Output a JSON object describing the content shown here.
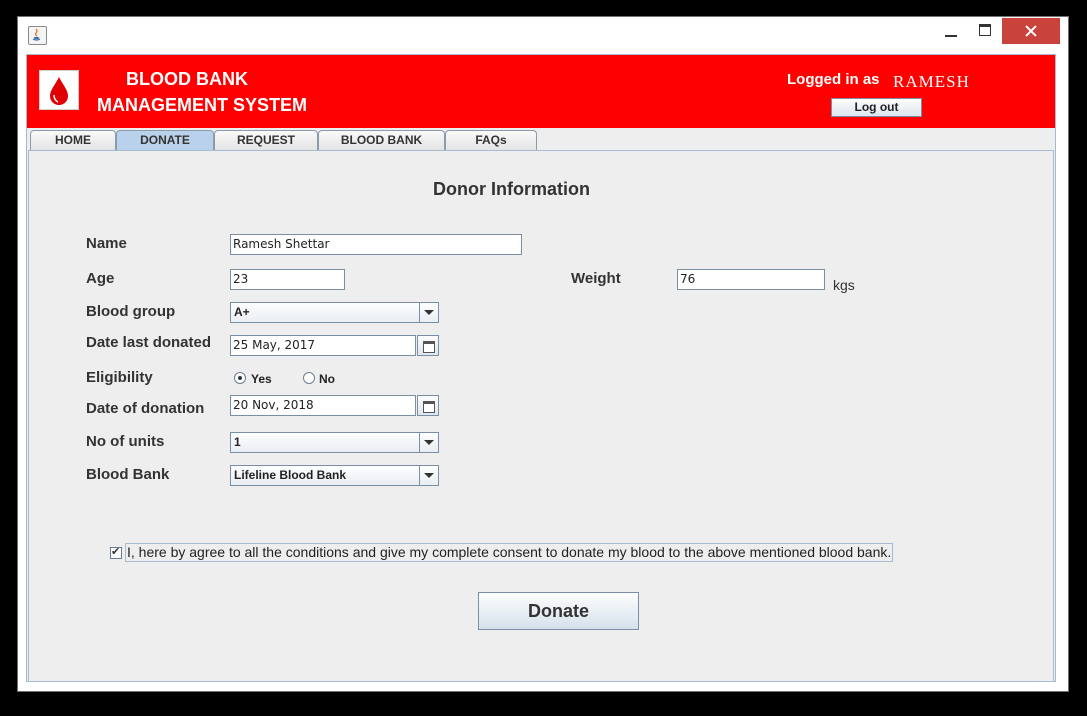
{
  "header": {
    "title_line1": "BLOOD BANK",
    "title_line2": "MANAGEMENT SYSTEM",
    "logged_in_label": "Logged in as",
    "user_name": "RAMESH",
    "logout_label": "Log out"
  },
  "tabs": [
    {
      "label": "HOME",
      "active": false
    },
    {
      "label": "DONATE",
      "active": true
    },
    {
      "label": "REQUEST",
      "active": false
    },
    {
      "label": "BLOOD BANK",
      "active": false
    },
    {
      "label": "FAQs",
      "active": false
    }
  ],
  "form": {
    "title": "Donor Information",
    "name_label": "Name",
    "name_value": "Ramesh Shettar",
    "age_label": "Age",
    "age_value": "23",
    "weight_label": "Weight",
    "weight_value": "76",
    "weight_units": "kgs",
    "blood_group_label": "Blood group",
    "blood_group_value": "A+",
    "date_last_label": "Date last donated",
    "date_last_value": "25 May, 2017",
    "eligibility_label": "Eligibility",
    "eligibility_yes": "Yes",
    "eligibility_no": "No",
    "eligibility_selected": "Yes",
    "date_donation_label": "Date of donation",
    "date_donation_value": "20 Nov, 2018",
    "units_label": "No of units",
    "units_value": "1",
    "blood_bank_label": "Blood Bank",
    "blood_bank_value": "Lifeline Blood Bank",
    "consent_text": "I, here by agree to all the conditions and give my complete consent to donate my blood to the above mentioned blood bank.",
    "consent_checked": true,
    "donate_label": "Donate"
  },
  "colors": {
    "header_bg": "#ff0000",
    "active_tab": "#b9d1ea",
    "close_button": "#c9423b"
  }
}
